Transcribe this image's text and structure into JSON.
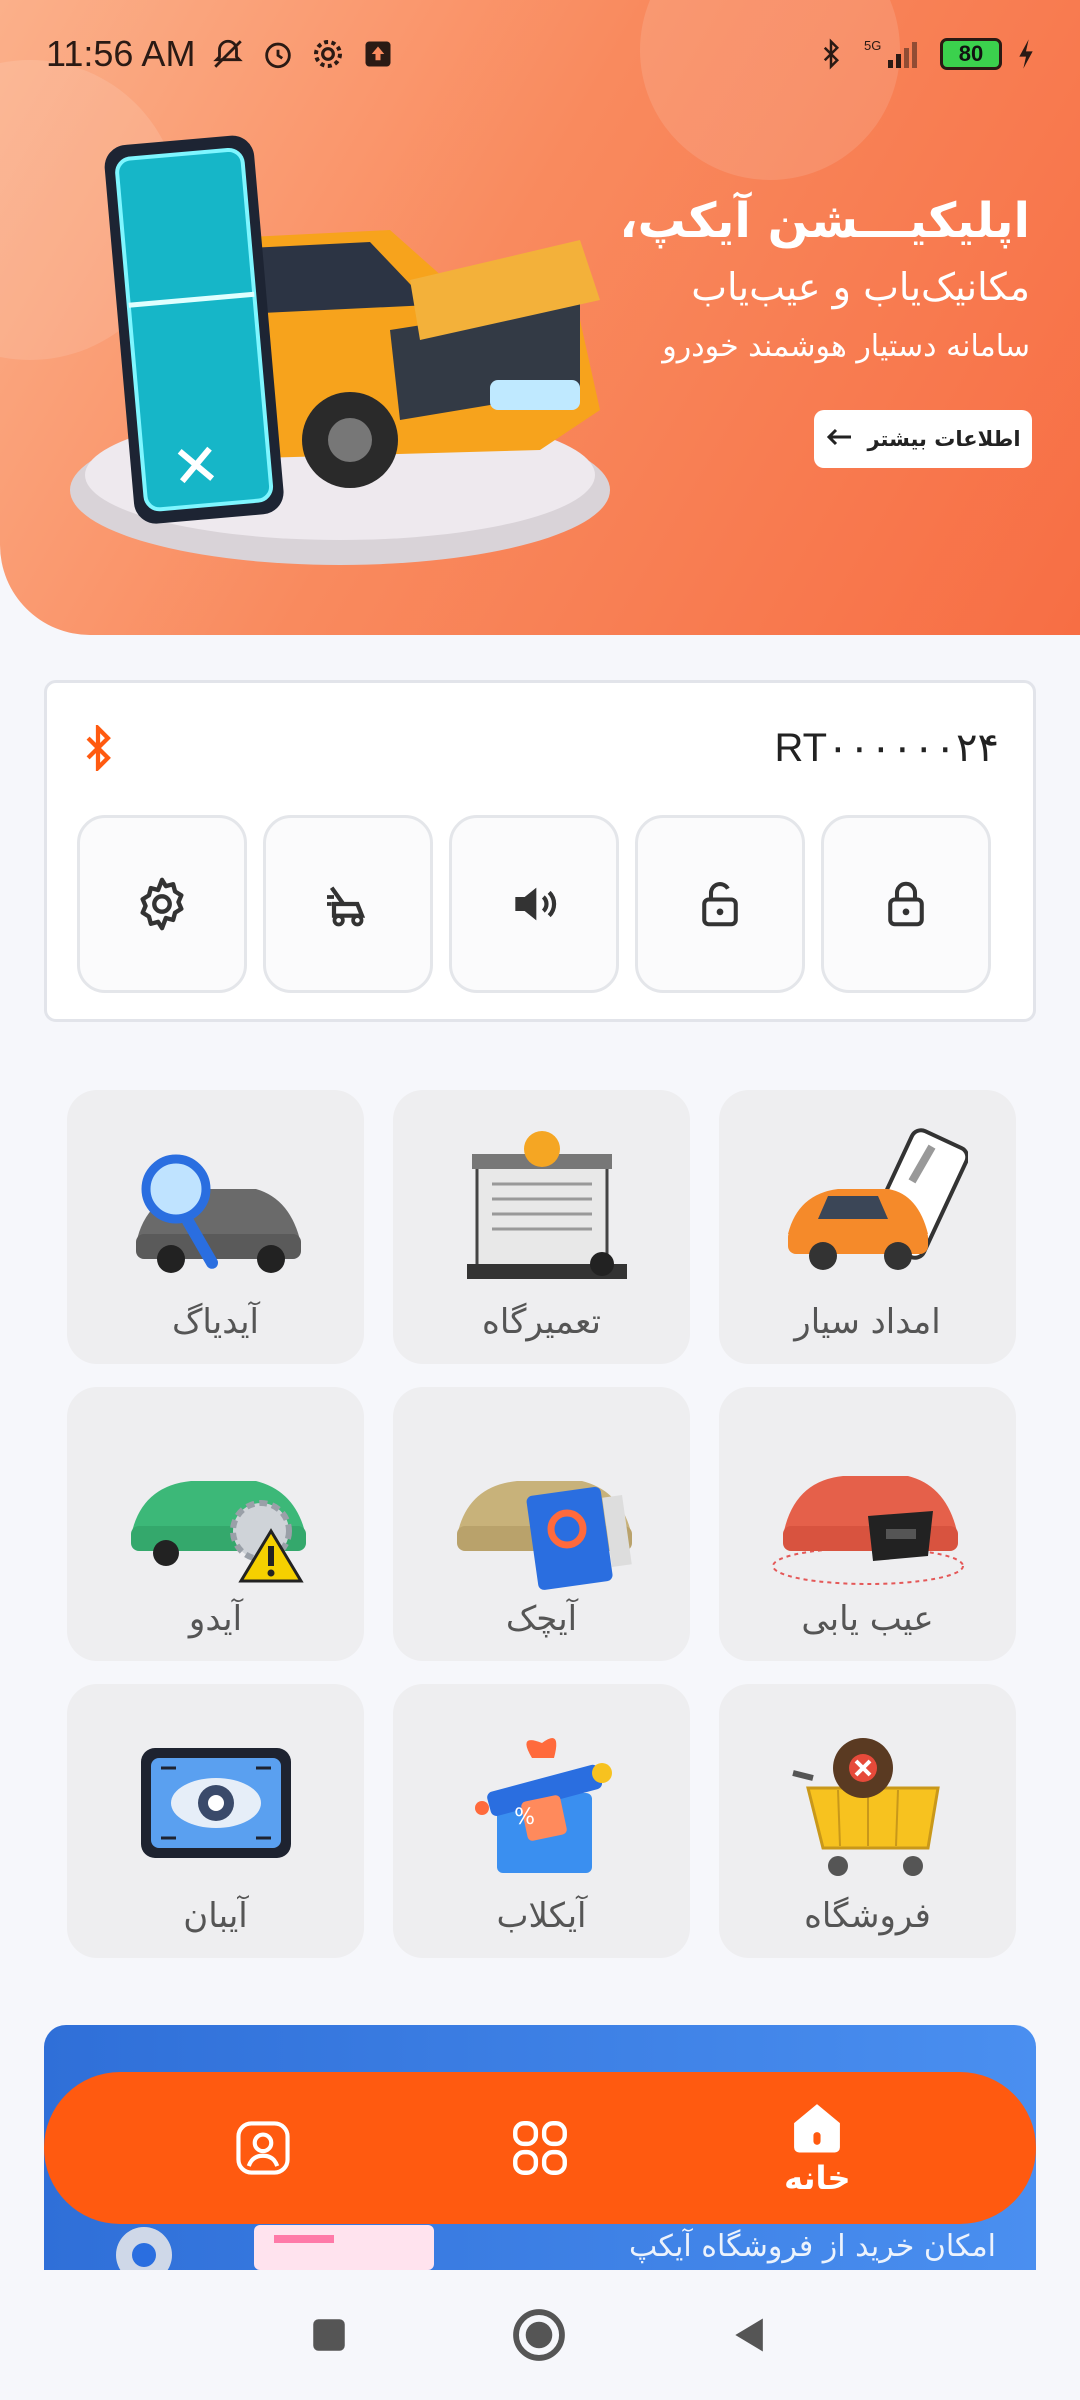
{
  "status_bar": {
    "time": "11:56 AM",
    "battery": "80",
    "network": "5G",
    "icons": [
      "muted-icon",
      "alarm-icon",
      "settings-icon",
      "upload-icon",
      "bluetooth-icon",
      "signal-icon",
      "battery-icon",
      "charging-icon"
    ]
  },
  "hero": {
    "title": "اپلیکیـــشن آیکپ،",
    "subtitle": "مکانیک‌یاب و عیب‌یاب",
    "tagline": "سامانه دستیار هوشمند خودرو",
    "more_button": "اطلاعات بیشتر"
  },
  "device": {
    "name": "RT۰۰۰۰۰۰۲۴",
    "controls": [
      {
        "icon": "settings-gear-icon"
      },
      {
        "icon": "trunk-icon"
      },
      {
        "icon": "horn-speaker-icon"
      },
      {
        "icon": "unlock-icon"
      },
      {
        "icon": "lock-icon"
      }
    ]
  },
  "services": [
    {
      "label": "امداد سیار",
      "icon": "roadside-assist-icon"
    },
    {
      "label": "تعمیرگاه",
      "icon": "repair-shop-icon"
    },
    {
      "label": "آیدیاگ",
      "icon": "diag-magnifier-icon"
    },
    {
      "label": "عیب یابی",
      "icon": "obd-scanner-icon"
    },
    {
      "label": "آیچک",
      "icon": "check-report-icon"
    },
    {
      "label": "آیدو",
      "icon": "car-warning-icon"
    },
    {
      "label": "فروشگاه",
      "icon": "shopping-cart-icon"
    },
    {
      "label": "آیکلاب",
      "icon": "gift-box-icon"
    },
    {
      "label": "آیبان",
      "icon": "eye-tablet-icon"
    }
  ],
  "banner": {
    "text": "امکان خرید از فروشگاه آیکپ"
  },
  "bottom_nav": {
    "home_label": "خانه"
  },
  "colors": {
    "accent": "#ff5a10",
    "hero_start": "#fbb08a",
    "hero_end": "#f76e44",
    "banner": "#3a7fe6"
  }
}
